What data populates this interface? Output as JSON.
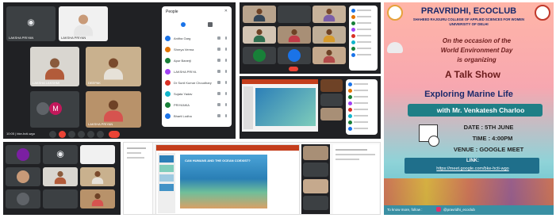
{
  "tl": {
    "tiles": [
      {
        "name": "LAKSHA PRIYAN"
      },
      {
        "name": "LAKSHA PRIYAN"
      },
      {
        "name": "LAKSHA LAKSHMI"
      },
      {
        "name": "DEEPAK"
      },
      {
        "name": "LAKSHA PRIYAN"
      }
    ],
    "avatar_letter": "M",
    "meeting_info": "10:05 | bke-hcti-wgo",
    "people_title": "People",
    "people": [
      {
        "name": "Anitha Garg",
        "color": "#1a73e8"
      },
      {
        "name": "Shreya Verma",
        "color": "#e37400"
      },
      {
        "name": "Apur Banerji",
        "color": "#188038"
      },
      {
        "name": "LAKSHA PRIYA",
        "color": "#a142f4"
      },
      {
        "name": "Dr Sunil Kumar Choudhary",
        "color": "#d93025"
      },
      {
        "name": "Sujata Yadav",
        "color": "#12b5cb"
      },
      {
        "name": "PRIYANKA",
        "color": "#188038"
      },
      {
        "name": "Bharti Lodha",
        "color": "#1a73e8"
      }
    ]
  },
  "poster": {
    "title": "PRAVRIDHI, ECOCLUB",
    "college": "SHAHEED RAJGURU COLLEGE OF APPLIED SCIENCES FOR WOMEN",
    "university": "UNIVERSITY OF DELHI",
    "occasion_1": "On the occasion of the",
    "occasion_2": "World Environment Day",
    "occasion_3": "is organizing",
    "event": "A Talk Show",
    "topic": "Exploring Marine Life",
    "speaker": "with Mr. Venkatesh Charloo",
    "date": "DATE : 5TH JUNE",
    "time": "TIME : 4:00PM",
    "venue": "VENUE : GOOGLE MEET",
    "link_label": "LINK:",
    "link": "https://meet.google.com/bke-hcti-wgo",
    "footer": "To know more, follow :",
    "handle": "@pravridhi_ecoclub"
  },
  "slide": {
    "heading": "CAN HUMANS AND THE OCEAN COEXIST?"
  }
}
